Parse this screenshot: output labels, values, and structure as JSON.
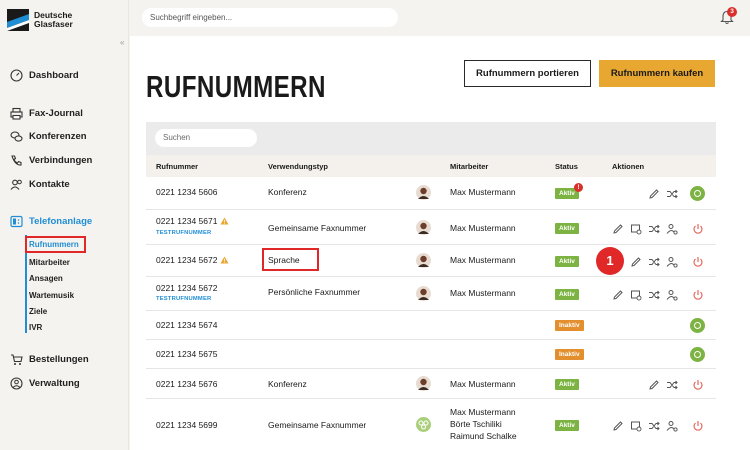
{
  "brand": {
    "line1": "Deutsche",
    "line2": "Glasfaser"
  },
  "sidebar": {
    "collapse_glyph": "«",
    "items": [
      {
        "label": "Dashboard",
        "icon": "gauge-icon"
      },
      {
        "label": "Fax-Journal",
        "icon": "printer-icon"
      },
      {
        "label": "Konferenzen",
        "icon": "chat-bubbles-icon"
      },
      {
        "label": "Verbindungen",
        "icon": "phone-icon"
      },
      {
        "label": "Kontakte",
        "icon": "contacts-icon"
      },
      {
        "label": "Telefonanlage",
        "icon": "phone-system-icon"
      },
      {
        "label": "Bestellungen",
        "icon": "cart-icon"
      },
      {
        "label": "Verwaltung",
        "icon": "user-circle-icon"
      }
    ],
    "subitems": [
      "Rufnummern",
      "Mitarbeiter",
      "Ansagen",
      "Wartemusik",
      "Ziele",
      "IVR"
    ]
  },
  "topbar": {
    "search_placeholder": "Suchbegriff eingeben...",
    "notification_count": "3"
  },
  "page": {
    "title": "RUFNUMMERN",
    "btn_port": "Rufnummern portieren",
    "btn_buy": "Rufnummern kaufen",
    "table_search_placeholder": "Suchen"
  },
  "table": {
    "headers": [
      "Rufnummer",
      "Verwendungstyp",
      "Mitarbeiter",
      "Status",
      "Aktionen"
    ],
    "rows": [
      {
        "number": "0221 1234 5606",
        "test": "",
        "warn": false,
        "type": "Konferenz",
        "employee": "Max Mustermann",
        "status": "Aktiv"
      },
      {
        "number": "0221 1234 5671",
        "test": "TESTRUFNUMMER",
        "warn": true,
        "type": "Gemeinsame Faxnummer",
        "employee": "Max Mustermann",
        "status": "Aktiv"
      },
      {
        "number": "0221 1234 5672",
        "test": "",
        "warn": true,
        "type": "Sprache",
        "employee": "Max Mustermann",
        "status": "Aktiv"
      },
      {
        "number": "0221 1234 5672",
        "test": "TESTRUFNUMMER",
        "warn": false,
        "type": "Persönliche Faxnummer",
        "employee": "Max Mustermann",
        "status": "Aktiv"
      },
      {
        "number": "0221 1234 5674",
        "test": "",
        "warn": false,
        "type": "",
        "employee": "",
        "status": "Inaktiv"
      },
      {
        "number": "0221 1234 5675",
        "test": "",
        "warn": false,
        "type": "",
        "employee": "",
        "status": "Inaktiv"
      },
      {
        "number": "0221 1234 5676",
        "test": "",
        "warn": false,
        "type": "Konferenz",
        "employee": "Max Mustermann",
        "status": "Aktiv"
      },
      {
        "number": "0221 1234 5699",
        "test": "",
        "warn": false,
        "type": "Gemeinsame Faxnummer",
        "employee_lines": [
          "Max Mustermann",
          "Börte Tschiliki",
          "Raimund Schalke"
        ],
        "status": "Aktiv"
      }
    ]
  },
  "status_alert": "!",
  "annotation": "1",
  "colors": {
    "accent": "#1f8ed4",
    "brand_orange": "#e8a730",
    "active": "#7cb342",
    "inactive": "#e38f2e",
    "alert": "#d9302b"
  }
}
